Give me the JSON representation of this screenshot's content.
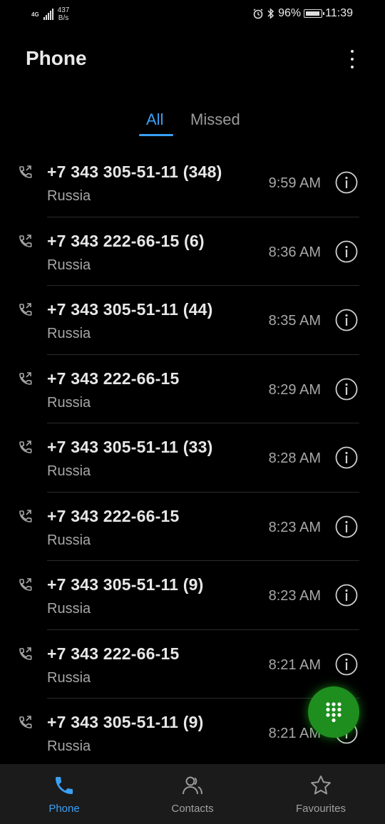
{
  "status": {
    "network": "4G",
    "speed_value": "437",
    "speed_unit": "B/s",
    "battery": "96%",
    "time": "11:39"
  },
  "header": {
    "title": "Phone"
  },
  "tabs": [
    {
      "label": "All",
      "active": true
    },
    {
      "label": "Missed",
      "active": false
    }
  ],
  "calls": [
    {
      "number": "+7 343 305-51-11 (348)",
      "location": "Russia",
      "time": "9:59 AM"
    },
    {
      "number": "+7 343 222-66-15 (6)",
      "location": "Russia",
      "time": "8:36 AM"
    },
    {
      "number": "+7 343 305-51-11 (44)",
      "location": "Russia",
      "time": "8:35 AM"
    },
    {
      "number": "+7 343 222-66-15",
      "location": "Russia",
      "time": "8:29 AM"
    },
    {
      "number": "+7 343 305-51-11 (33)",
      "location": "Russia",
      "time": "8:28 AM"
    },
    {
      "number": "+7 343 222-66-15",
      "location": "Russia",
      "time": "8:23 AM"
    },
    {
      "number": "+7 343 305-51-11 (9)",
      "location": "Russia",
      "time": "8:23 AM"
    },
    {
      "number": "+7 343 222-66-15",
      "location": "Russia",
      "time": "8:21 AM"
    },
    {
      "number": "+7 343 305-51-11 (9)",
      "location": "Russia",
      "time": "8:21 AM"
    }
  ],
  "nav": [
    {
      "label": "Phone",
      "icon": "phone-icon",
      "active": true
    },
    {
      "label": "Contacts",
      "icon": "contacts-icon",
      "active": false
    },
    {
      "label": "Favourites",
      "icon": "star-icon",
      "active": false
    }
  ],
  "colors": {
    "accent": "#3aa0f5",
    "fab": "#1e8e1e",
    "background": "#000000",
    "nav_bg": "#1b1b1b"
  }
}
